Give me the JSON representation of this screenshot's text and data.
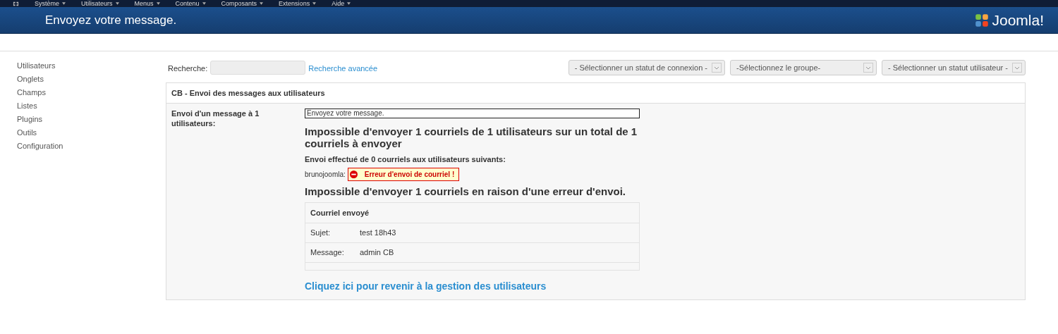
{
  "top_menu": [
    "Système",
    "Utilisateurs",
    "Menus",
    "Contenu",
    "Composants",
    "Extensions",
    "Aide"
  ],
  "header": {
    "title": "Envoyez votre message.",
    "logo_text": "Joomla!"
  },
  "sidebar": {
    "items": [
      {
        "label": "Utilisateurs"
      },
      {
        "label": "Onglets"
      },
      {
        "label": "Champs"
      },
      {
        "label": "Listes"
      },
      {
        "label": "Plugins"
      },
      {
        "label": "Outils"
      },
      {
        "label": "Configuration"
      }
    ]
  },
  "search": {
    "label": "Recherche:",
    "advanced_link": "Recherche avancée"
  },
  "filters": [
    "- Sélectionner un statut de connexion -",
    "-Sélectionnez le groupe-",
    "- Sélectionner un statut utilisateur -"
  ],
  "panel": {
    "title": "CB - Envoi des messages aux utilisateurs",
    "row_label": "Envoi d'un message à 1 utilisateurs:",
    "status_field": "Envoyez votre message.",
    "heading": "Impossible d'envoyer 1 courriels de 1 utilisateurs sur un total de 1 courriels à envoyer",
    "subheading": "Envoi effectué de 0 courriels aux utilisateurs suivants:",
    "recipients": [
      {
        "name": "brunojoomla:",
        "error": "Erreur d'envoi de courriel !"
      }
    ],
    "error_heading": "Impossible d'envoyer 1 courriels en raison d'une erreur d'envoi.",
    "sent_mail": {
      "title": "Courriel envoyé",
      "rows": [
        {
          "label": "Sujet:",
          "value": "test 18h43"
        },
        {
          "label": "Message:",
          "value": "admin CB"
        }
      ]
    },
    "back_link": "Cliquez ici pour revenir à la gestion des utilisateurs"
  }
}
